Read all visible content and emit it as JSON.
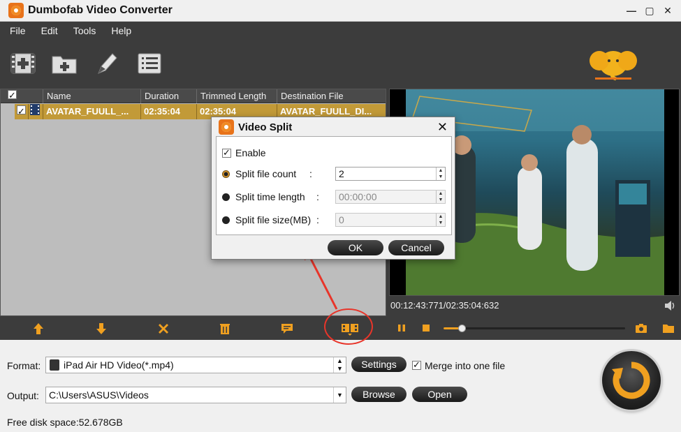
{
  "window": {
    "title": "Dumbofab Video Converter"
  },
  "menu": [
    {
      "label": "File"
    },
    {
      "label": "Edit"
    },
    {
      "label": "Tools"
    },
    {
      "label": "Help"
    }
  ],
  "file_list": {
    "columns": [
      "Name",
      "Duration",
      "Trimmed Length",
      "Destination File"
    ],
    "rows": [
      {
        "name": "AVATAR_FUULL_...",
        "duration": "02:35:04",
        "trimmed": "02:35:04",
        "destination": "AVATAR_FUULL_DI..."
      }
    ]
  },
  "preview": {
    "time": "00:12:43:771/02:35:04:632",
    "progress": 0.1
  },
  "dialog": {
    "title": "Video Split",
    "enable_label": "Enable",
    "split_count_label": "Split file count",
    "split_count_value": "2",
    "split_time_label": "Split time length",
    "split_time_value": "00:00:00",
    "split_size_label": "Split file size(MB)",
    "split_size_value": "0",
    "colon": ":",
    "ok_label": "OK",
    "cancel_label": "Cancel"
  },
  "bottom": {
    "format_label": "Format:",
    "format_value": "iPad Air HD Video(*.mp4)",
    "settings_label": "Settings",
    "merge_label": "Merge into one file",
    "output_label": "Output:",
    "output_value": "C:\\Users\\ASUS\\Videos",
    "browse_label": "Browse",
    "open_label": "Open",
    "disk_space": "Free disk space:52.678GB"
  },
  "colors": {
    "accent": "#e8731a",
    "selected_row": "#c29a38",
    "annotation": "#e8352a"
  }
}
